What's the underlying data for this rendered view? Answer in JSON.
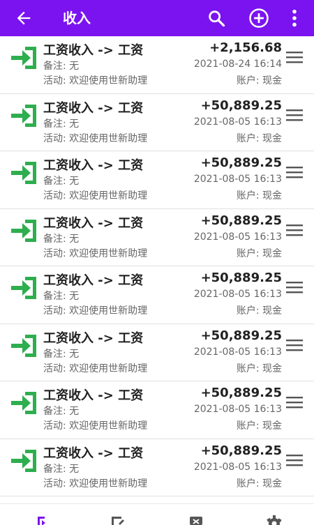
{
  "appbar": {
    "title": "收入",
    "background": "#7b13f0",
    "icons": [
      "arrow-back-icon",
      "search-icon",
      "add-circle-icon",
      "more-vert-icon"
    ]
  },
  "accent_green": "#2eae4f",
  "records": [
    {
      "title": "工资收入 -> 工资",
      "note": "备注: 无",
      "activity": "活动: 欢迎使用世新助理",
      "amount": "+2,156.68",
      "time": "2021-08-24 16:14",
      "account": "账户: 现金"
    },
    {
      "title": "工资收入 -> 工资",
      "note": "备注: 无",
      "activity": "活动: 欢迎使用世新助理",
      "amount": "+50,889.25",
      "time": "2021-08-05 16:13",
      "account": "账户: 现金"
    },
    {
      "title": "工资收入 -> 工资",
      "note": "备注: 无",
      "activity": "活动: 欢迎使用世新助理",
      "amount": "+50,889.25",
      "time": "2021-08-05 16:13",
      "account": "账户: 现金"
    },
    {
      "title": "工资收入 -> 工资",
      "note": "备注: 无",
      "activity": "活动: 欢迎使用世新助理",
      "amount": "+50,889.25",
      "time": "2021-08-05 16:13",
      "account": "账户: 现金"
    },
    {
      "title": "工资收入 -> 工资",
      "note": "备注: 无",
      "activity": "活动: 欢迎使用世新助理",
      "amount": "+50,889.25",
      "time": "2021-08-05 16:13",
      "account": "账户: 现金"
    },
    {
      "title": "工资收入 -> 工资",
      "note": "备注: 无",
      "activity": "活动: 欢迎使用世新助理",
      "amount": "+50,889.25",
      "time": "2021-08-05 16:13",
      "account": "账户: 现金"
    },
    {
      "title": "工资收入 -> 工资",
      "note": "备注: 无",
      "activity": "活动: 欢迎使用世新助理",
      "amount": "+50,889.25",
      "time": "2021-08-05 16:13",
      "account": "账户: 现金"
    },
    {
      "title": "工资收入 -> 工资",
      "note": "备注: 无",
      "activity": "活动: 欢迎使用世新助理",
      "amount": "+50,889.25",
      "time": "2021-08-05 16:13",
      "account": "账户: 现金"
    }
  ],
  "bottom_nav": [
    "income-tab-icon",
    "edit-tab-icon",
    "report-tab-icon",
    "settings-tab-icon"
  ]
}
